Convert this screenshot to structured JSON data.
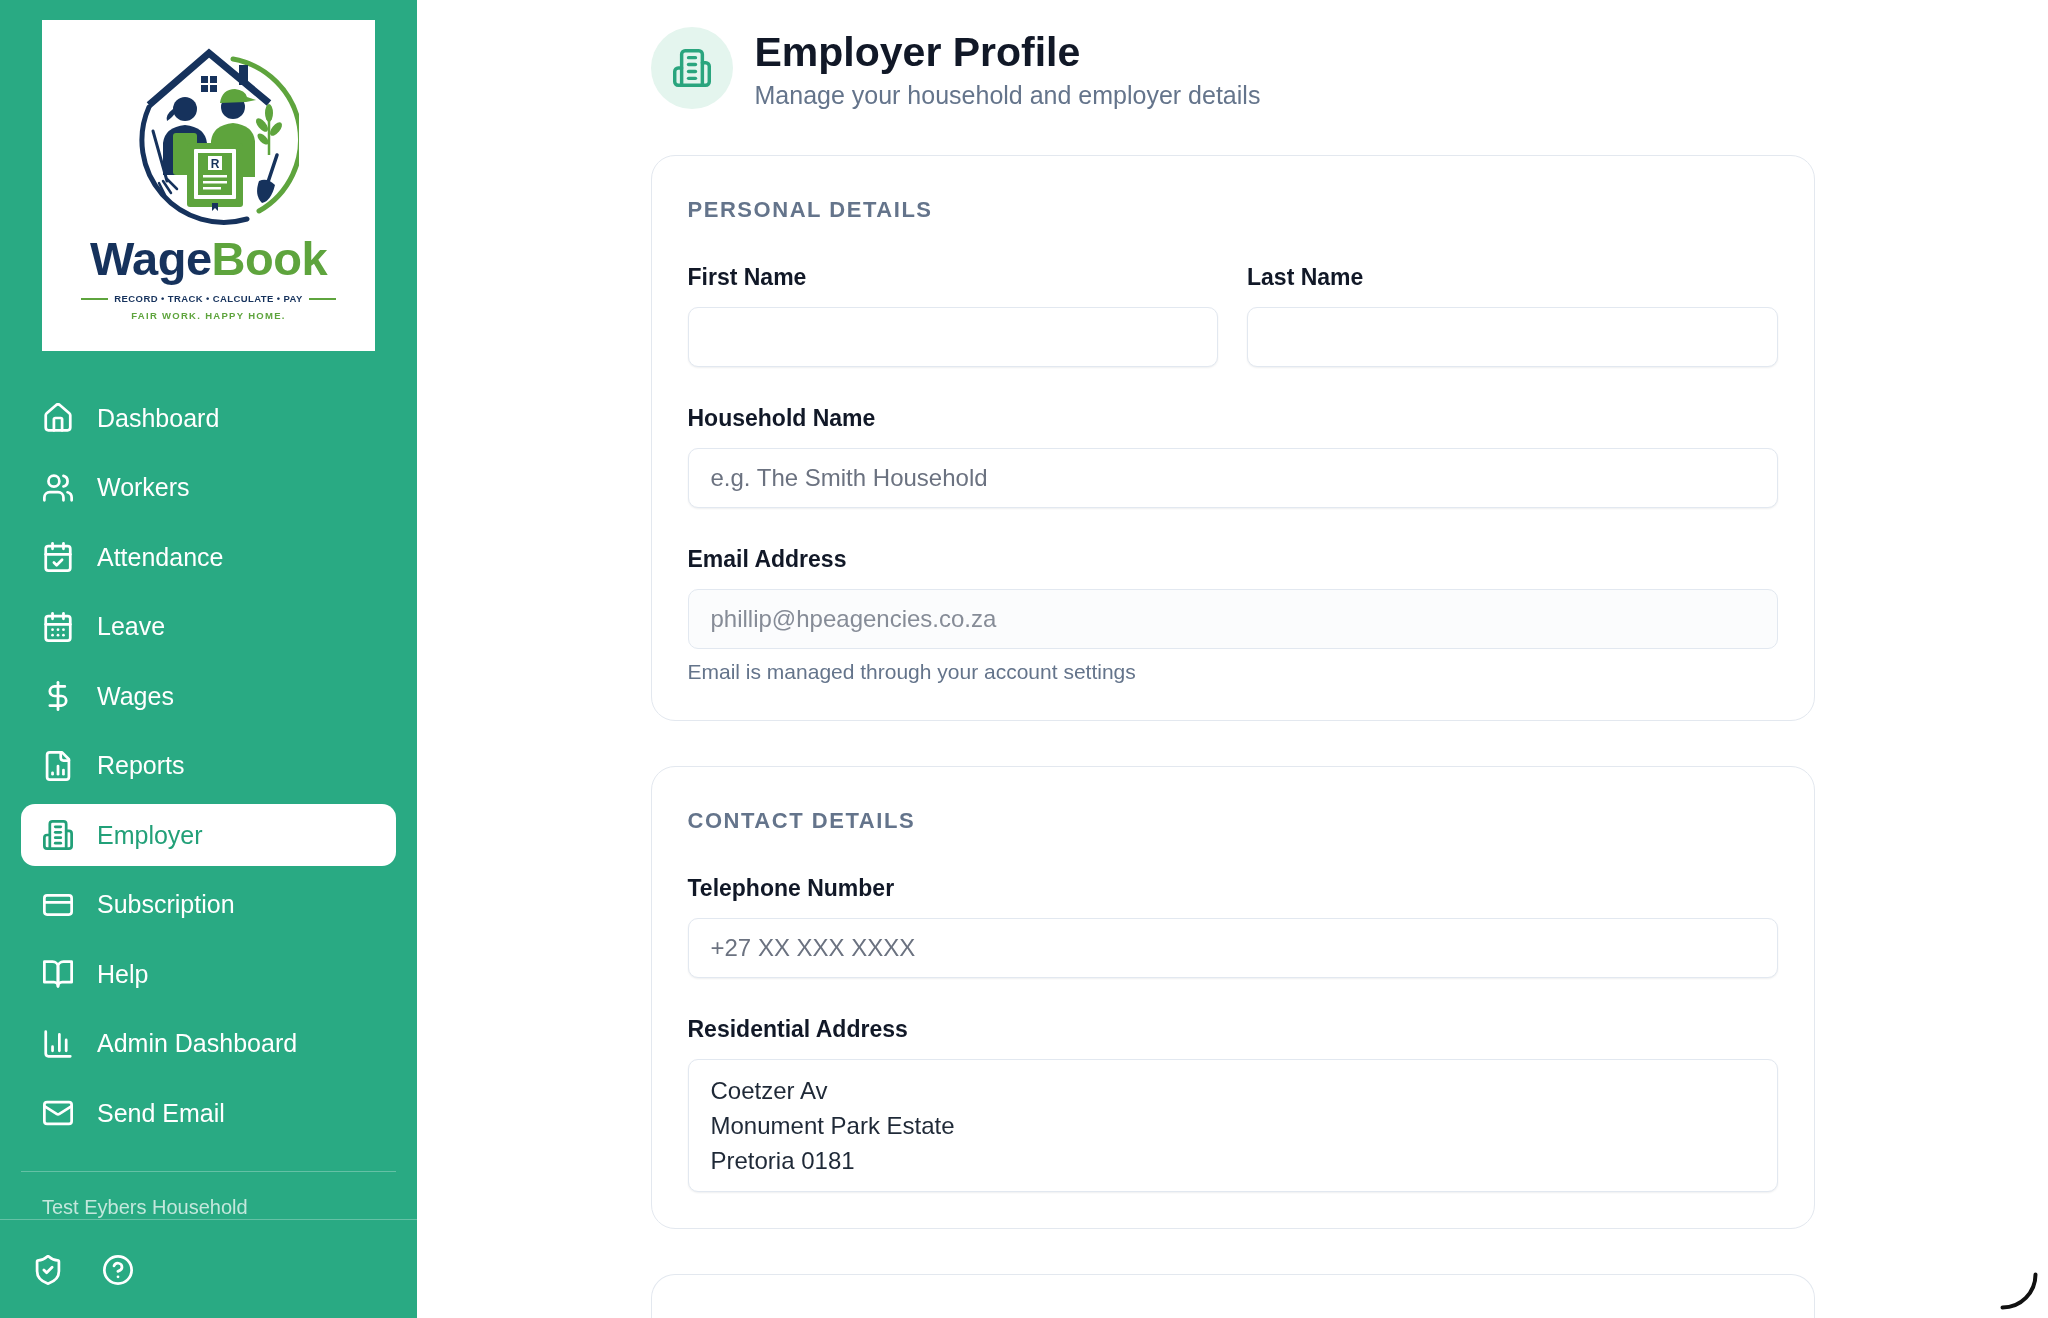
{
  "sidebar": {
    "logo": {
      "book_letter": "R",
      "wordmark_first": "Wage",
      "wordmark_second": "Book",
      "tagline": "RECORD • TRACK • CALCULATE • PAY",
      "motto": "FAIR WORK. HAPPY HOME."
    },
    "nav": [
      {
        "label": "Dashboard",
        "selected": false
      },
      {
        "label": "Workers",
        "selected": false
      },
      {
        "label": "Attendance",
        "selected": false
      },
      {
        "label": "Leave",
        "selected": false
      },
      {
        "label": "Wages",
        "selected": false
      },
      {
        "label": "Reports",
        "selected": false
      },
      {
        "label": "Employer",
        "selected": true
      },
      {
        "label": "Subscription",
        "selected": false
      },
      {
        "label": "Help",
        "selected": false
      },
      {
        "label": "Admin Dashboard",
        "selected": false
      },
      {
        "label": "Send Email",
        "selected": false
      }
    ],
    "household": "Test Eybers Household"
  },
  "header": {
    "title": "Employer Profile",
    "subtitle": "Manage your household and employer details"
  },
  "sections": [
    {
      "kind": "form",
      "title": "PERSONAL DETAILS",
      "rows": [
        [
          {
            "kind": "text",
            "label": "First Name",
            "disabled": false
          },
          {
            "kind": "text",
            "label": "Last Name",
            "disabled": false
          }
        ],
        [
          {
            "kind": "text",
            "label": "Household Name",
            "placeholder": "e.g. The Smith Household",
            "disabled": false
          }
        ],
        [
          {
            "kind": "text",
            "label": "Email Address",
            "value": "phillip@hpeagencies.co.za",
            "disabled": true,
            "hint": "Email is managed through your account settings"
          }
        ]
      ]
    },
    {
      "kind": "form",
      "title": "CONTACT DETAILS",
      "rows": [
        [
          {
            "kind": "text",
            "label": "Telephone Number",
            "placeholder": "+27 XX XXX XXXX",
            "disabled": false
          }
        ],
        [
          {
            "kind": "textarea",
            "label": "Residential Address",
            "value": "Coetzer Av\nMonument Park Estate\nPretoria 0181",
            "disabled": false
          }
        ]
      ]
    },
    {
      "kind": "cut_off"
    }
  ]
}
